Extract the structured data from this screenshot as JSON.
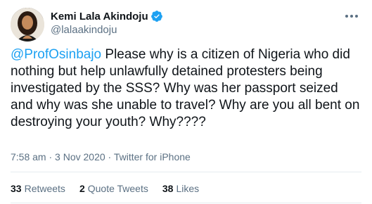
{
  "author": {
    "display_name": "Kemi Lala Akindoju",
    "handle": "@lalaakindoju",
    "verified": true
  },
  "tweet": {
    "mention": "@ProfOsinbajo",
    "text": " Please why is a citizen of Nigeria who did nothing but help unlawfully detained protesters being investigated by the SSS? Why was her passport seized and why was she unable to travel? Why are you all bent on destroying your youth? Why????",
    "time": "7:58 am",
    "separator": " · ",
    "date": "3 Nov 2020",
    "source": "Twitter for iPhone"
  },
  "stats": {
    "retweets_count": "33",
    "retweets_label": "Retweets",
    "quotes_count": "2",
    "quotes_label": "Quote Tweets",
    "likes_count": "38",
    "likes_label": "Likes"
  },
  "colors": {
    "link": "#1da1f2",
    "secondary_text": "#5b7083",
    "primary_text": "#0f1419",
    "verified": "#1da1f2"
  },
  "icons": [
    "verified-badge-icon",
    "more-options-icon"
  ]
}
